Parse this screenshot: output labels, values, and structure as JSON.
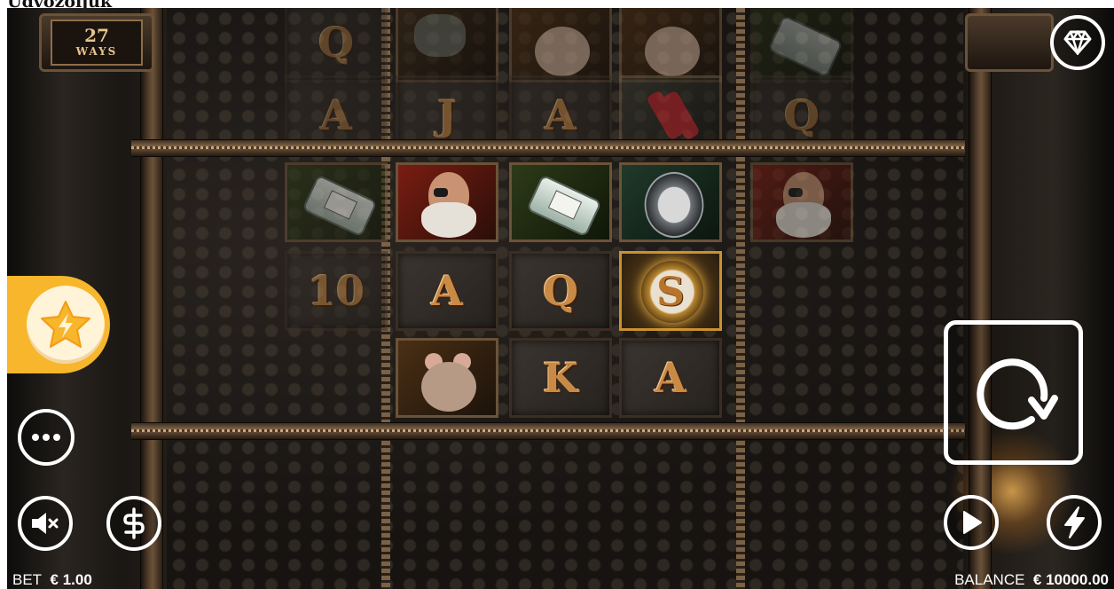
{
  "page_heading": "Üdvözöljük",
  "game": {
    "ways_count": "27",
    "ways_label": "WAYS",
    "bet_label": "BET",
    "bet_value": "€ 1.00",
    "balance_label": "BALANCE",
    "balance_value": "€ 10000.00"
  },
  "reels": {
    "top_dim_row": [
      {
        "symbol": "Q"
      },
      {
        "symbol": "tobacco-pouch-symbol"
      },
      {
        "symbol": "rat-symbol"
      },
      {
        "symbol": "rat-symbol"
      },
      {
        "symbol": "bottle-symbol"
      }
    ],
    "second_dim_row": [
      {
        "symbol": "A"
      },
      {
        "symbol": "J"
      },
      {
        "symbol": "A"
      },
      {
        "symbol": "dynamite-symbol"
      },
      {
        "symbol": "Q"
      }
    ],
    "active_rows": [
      [
        {
          "symbol": "bottle-symbol",
          "state": "dim"
        },
        {
          "symbol": "miner-face-symbol"
        },
        {
          "symbol": "bottle-symbol"
        },
        {
          "symbol": "compass-symbol"
        },
        {
          "symbol": "miner-face-symbol",
          "state": "dim"
        }
      ],
      [
        {
          "symbol": "10",
          "state": "dim"
        },
        {
          "symbol": "A"
        },
        {
          "symbol": "Q"
        },
        {
          "symbol": "wild-s-symbol",
          "text": "S"
        },
        {
          "symbol": "empty"
        }
      ],
      [
        {
          "symbol": "empty"
        },
        {
          "symbol": "rat-symbol"
        },
        {
          "symbol": "K"
        },
        {
          "symbol": "A"
        },
        {
          "symbol": "empty"
        }
      ]
    ]
  },
  "colors": {
    "accent": "#f7b62b",
    "letter": "#c98a46",
    "ui_white": "#ffffff"
  }
}
